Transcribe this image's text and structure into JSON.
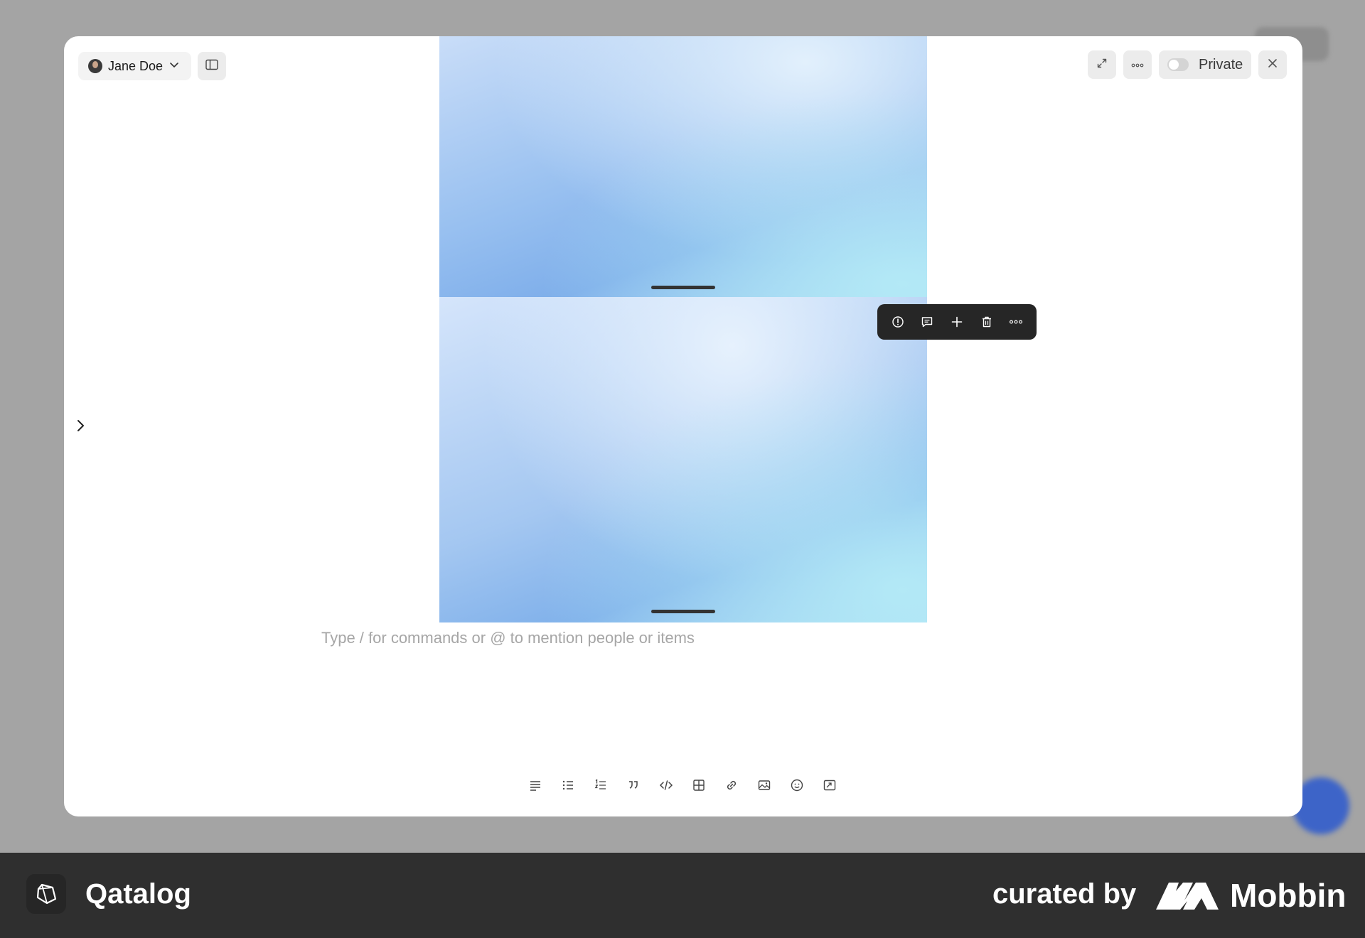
{
  "header": {
    "user_name": "Jane Doe",
    "privacy_label": "Private",
    "privacy_enabled": false
  },
  "editor": {
    "placeholder": "Type / for commands or @ to mention people or items"
  },
  "block_toolbar": {
    "icons": [
      "info-icon",
      "comment-icon",
      "plus-icon",
      "trash-icon",
      "more-icon"
    ]
  },
  "format_toolbar": {
    "icons": [
      "paragraph-icon",
      "bullet-list-icon",
      "numbered-list-icon",
      "quote-icon",
      "code-icon",
      "table-icon",
      "link-icon",
      "image-icon",
      "emoji-icon",
      "embed-icon"
    ]
  },
  "footer": {
    "app_name": "Qatalog",
    "curated_by": "curated by",
    "brand": "Mobbin"
  },
  "colors": {
    "footer_bg": "#2f2f2f",
    "backdrop": "#a4a4a4",
    "toolbar_bg": "#262626"
  }
}
